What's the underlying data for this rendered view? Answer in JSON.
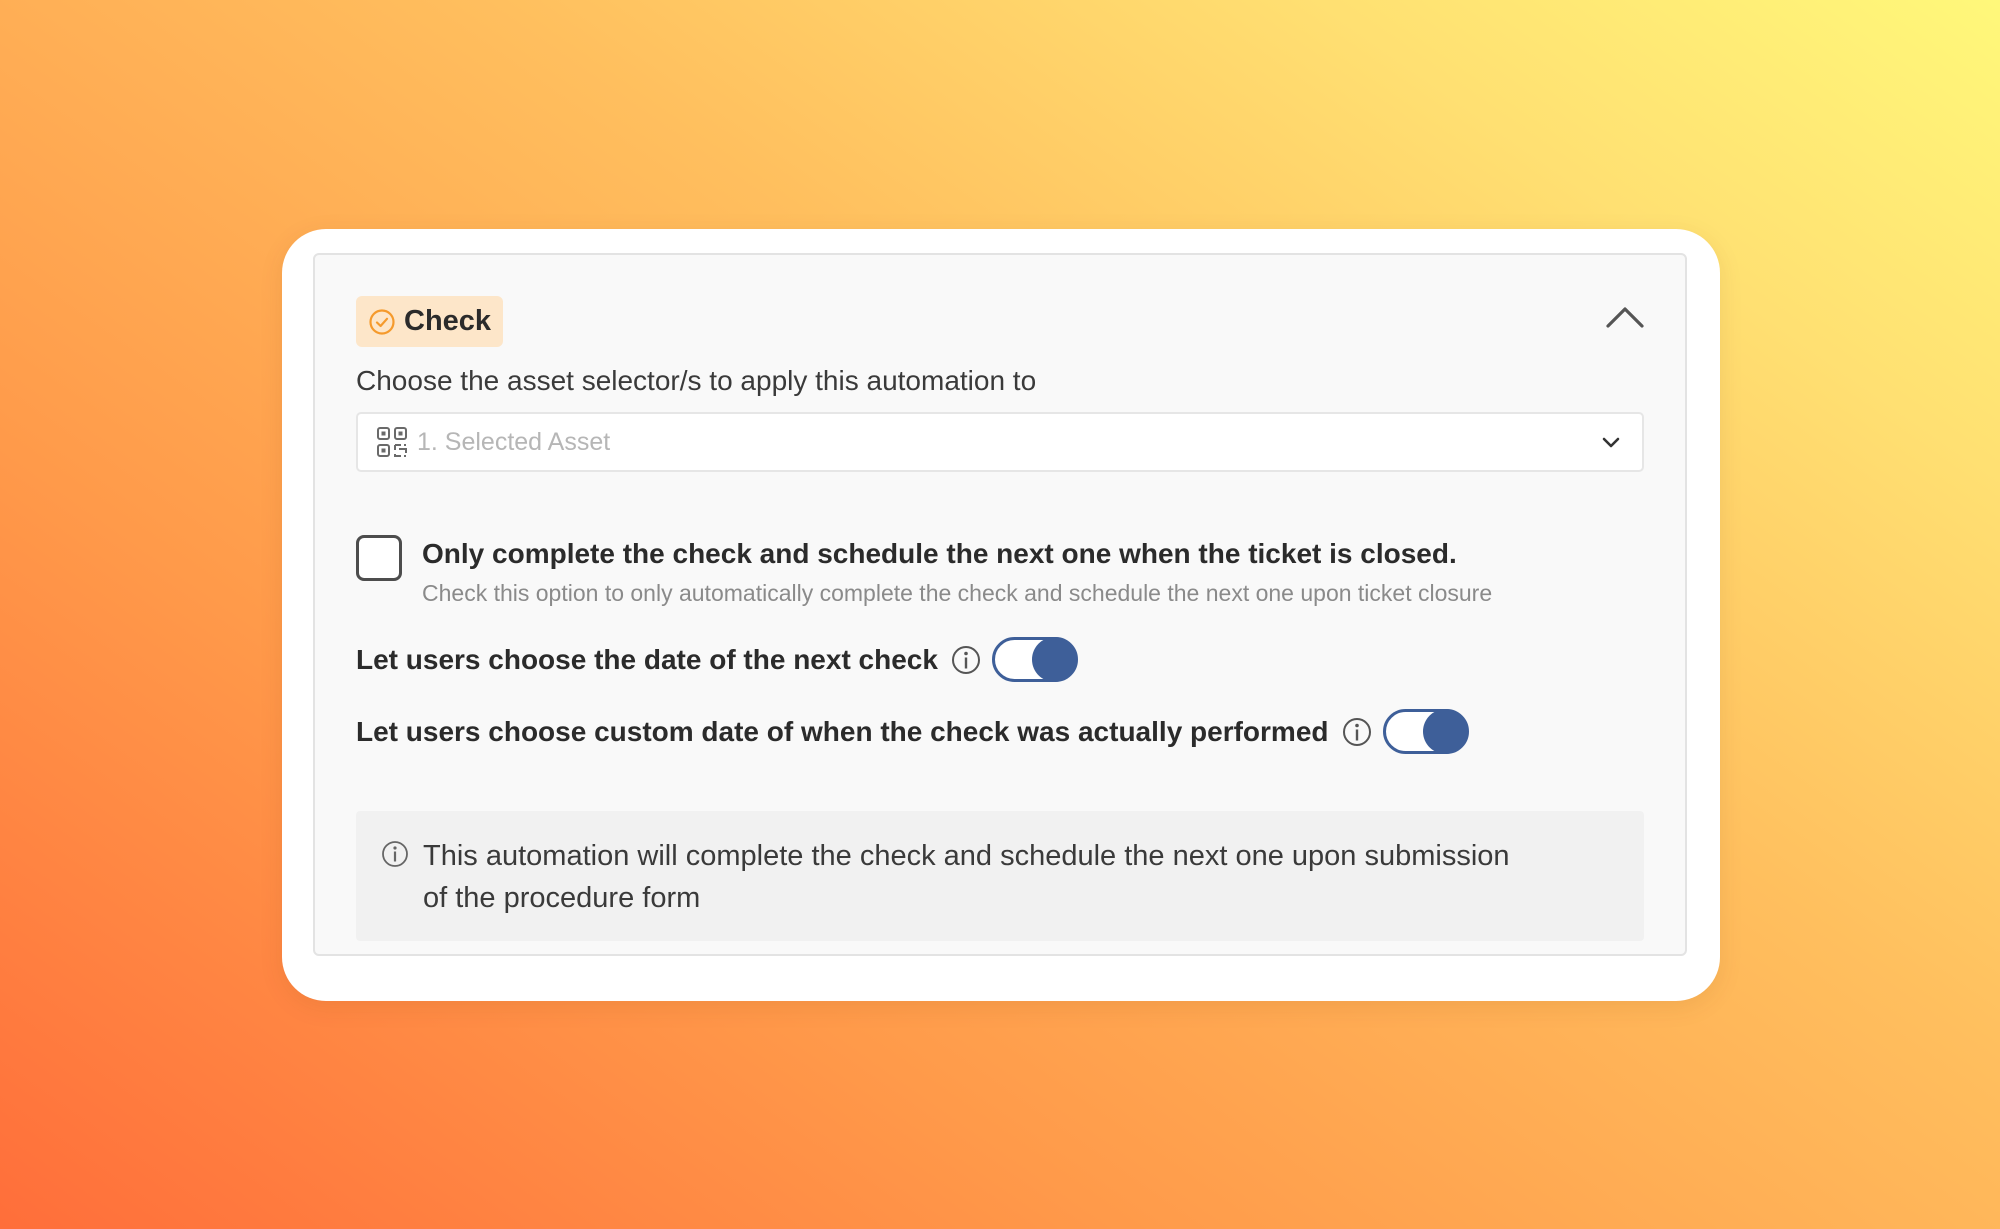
{
  "colors": {
    "accent": "#3e5f99",
    "badge_background": "#fde6c9",
    "badge_icon": "#f59a2c",
    "panel_background": "#f9f9f9"
  },
  "header": {
    "badge_icon": "check-circle-icon",
    "badge_label": "Check",
    "collapse_icon": "chevron-up-icon"
  },
  "asset_selector": {
    "label": "Choose the asset selector/s to apply this automation to",
    "icon": "qr-code-icon",
    "placeholder": "1. Selected Asset",
    "dropdown_icon": "chevron-down-icon"
  },
  "ticket_closure_option": {
    "checked": false,
    "title": "Only complete the check and schedule the next one when the ticket is closed.",
    "description": "Check this option to only automatically complete the check and schedule the next one upon ticket closure"
  },
  "toggles": [
    {
      "label": "Let users choose the date of the next check",
      "info_icon": "info-icon",
      "enabled": true
    },
    {
      "label": "Let users choose custom date of when the check was actually performed",
      "info_icon": "info-icon",
      "enabled": true
    }
  ],
  "info_notice": {
    "icon": "info-icon",
    "text": "This automation will complete the check and schedule the next one upon submission of the procedure form"
  }
}
